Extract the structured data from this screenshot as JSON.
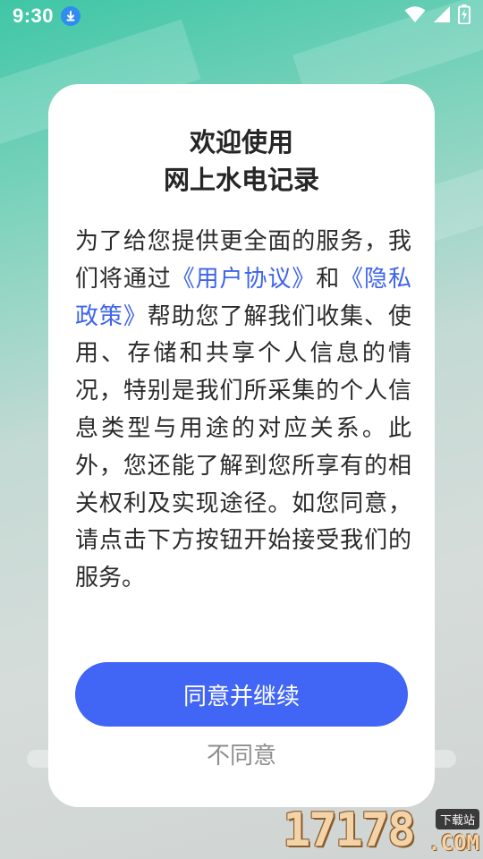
{
  "status_bar": {
    "time": "9:30",
    "icons": [
      "download-icon",
      "wifi-icon",
      "signal-icon",
      "battery-charging-icon"
    ]
  },
  "dialog": {
    "title_line1": "欢迎使用",
    "title_line2": "网上水电记录",
    "body_before": "为了给您提供更全面的服务，我们将通过",
    "link_user_agreement": "《用户协议》",
    "body_and": "和",
    "link_privacy_policy": "《隐私政策》",
    "body_after": "帮助您了解我们收集、使用、存储和共享个人信息的情况，特别是我们所采集的个人信息类型与用途的对应关系。此外，您还能了解到您所享有的相关权利及实现途径。如您同意，请点击下方按钮开始接受我们的服务。",
    "agree_button": "同意并继续",
    "disagree_button": "不同意"
  },
  "watermark": {
    "number": "17178",
    "tag": "下载站",
    "domain": ".COM"
  },
  "colors": {
    "accent": "#4165f4",
    "link": "#3d64ea",
    "status_icon": "#2f8cf0"
  }
}
